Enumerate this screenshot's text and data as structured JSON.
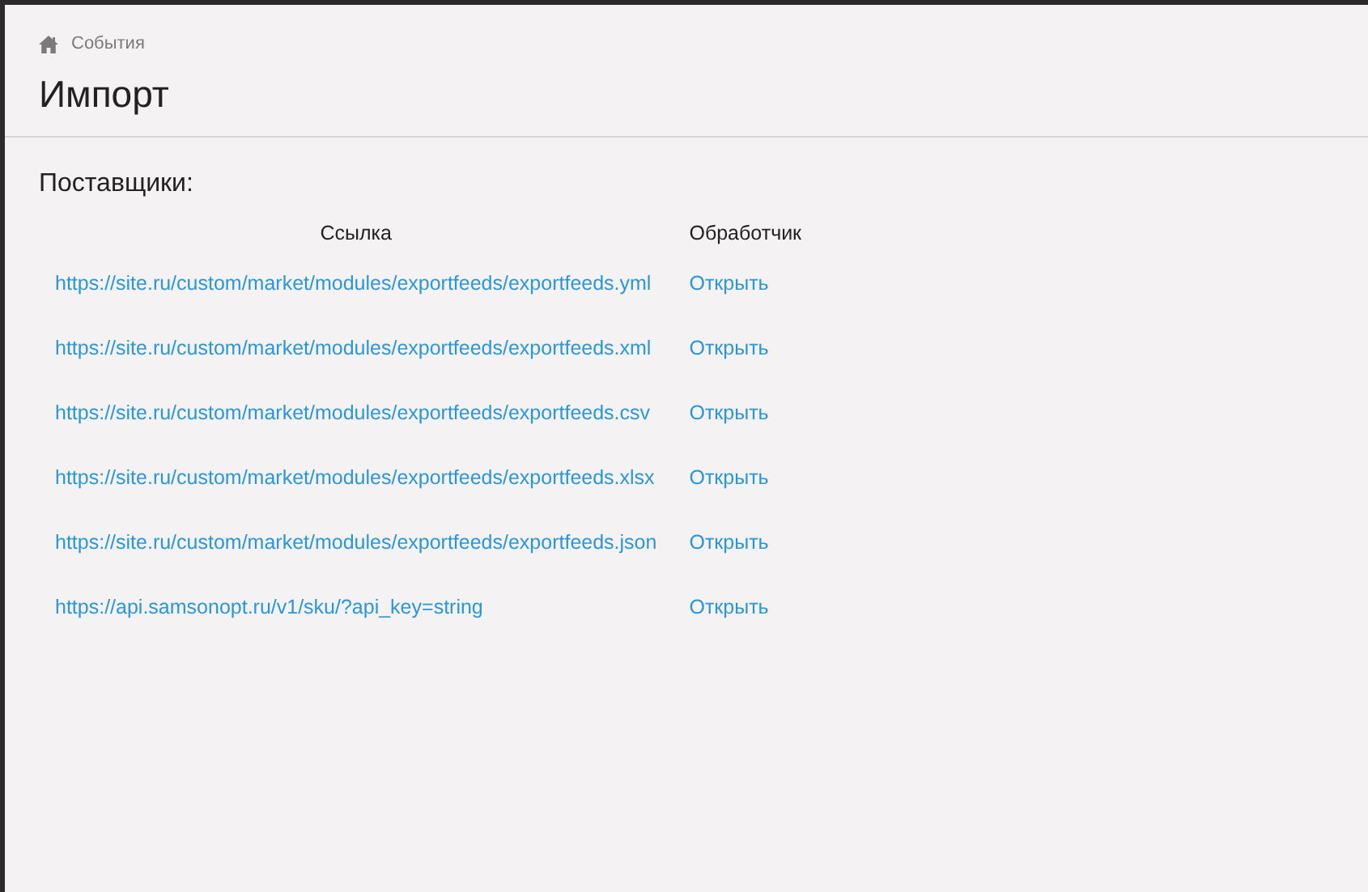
{
  "breadcrumb": {
    "label": "События"
  },
  "title": "Импорт",
  "section_title": "Поставщики:",
  "table": {
    "columns": [
      "Ссылка",
      "Обработчик"
    ],
    "rows": [
      {
        "url": "https://site.ru/custom/market/modules/exportfeeds/exportfeeds.yml",
        "action": "Открыть"
      },
      {
        "url": "https://site.ru/custom/market/modules/exportfeeds/exportfeeds.xml",
        "action": "Открыть"
      },
      {
        "url": "https://site.ru/custom/market/modules/exportfeeds/exportfeeds.csv",
        "action": "Открыть"
      },
      {
        "url": "https://site.ru/custom/market/modules/exportfeeds/exportfeeds.xlsx",
        "action": "Открыть"
      },
      {
        "url": "https://site.ru/custom/market/modules/exportfeeds/exportfeeds.json",
        "action": "Открыть"
      },
      {
        "url": "https://api.samsonopt.ru/v1/sku/?api_key=string",
        "action": "Открыть"
      }
    ]
  }
}
